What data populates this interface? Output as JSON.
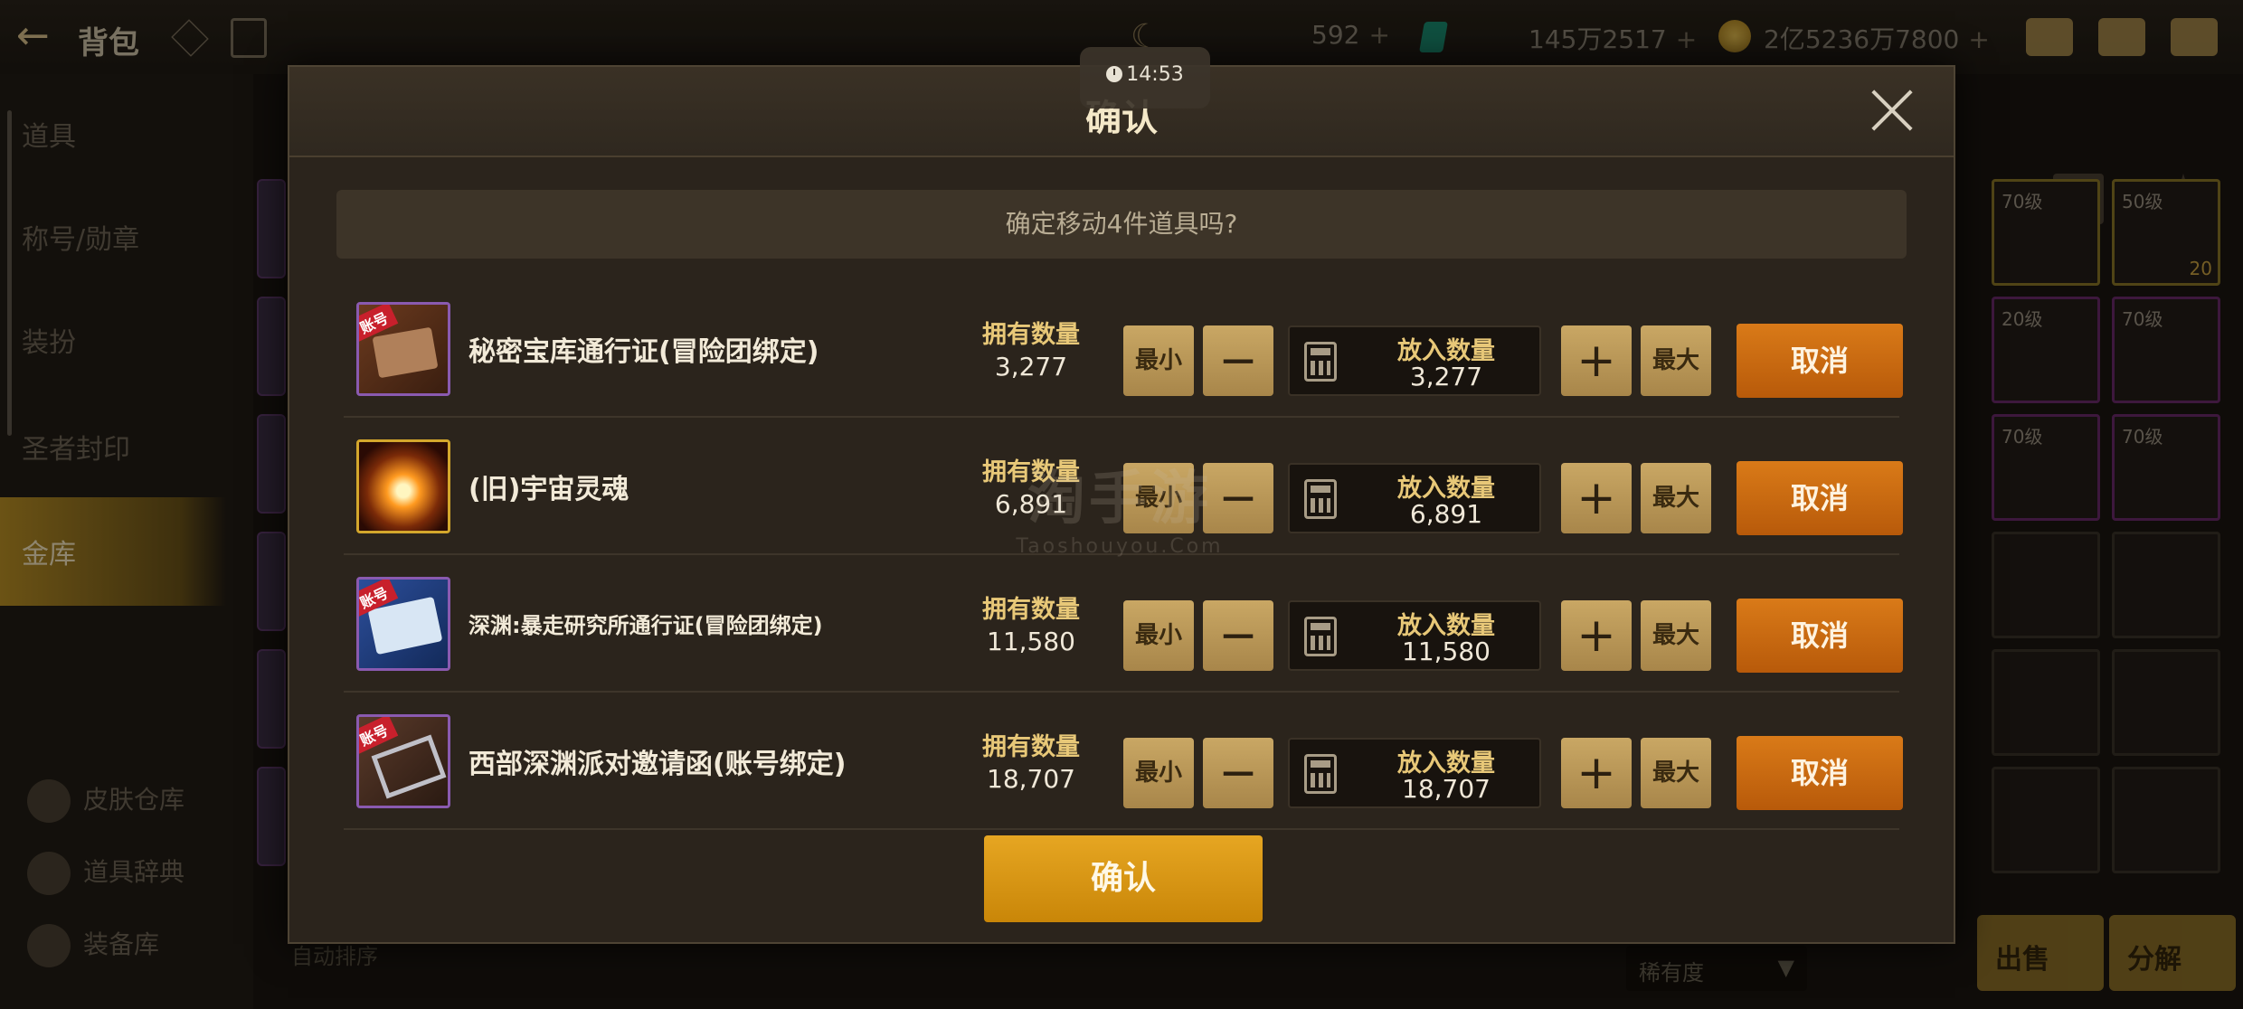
{
  "background": {
    "title": "背包",
    "currencies": [
      {
        "value": "592"
      },
      {
        "value": "145万2517"
      },
      {
        "value": "2亿5236万7800"
      }
    ],
    "sidebar": [
      "道具",
      "称号/勋章",
      "装扮",
      "圣者封印",
      "金库"
    ],
    "sidebar_active": "金库",
    "sidebar_bottom": [
      "皮肤仓库",
      "道具辞典",
      "装备库"
    ],
    "bottom_left": "自动排序",
    "sort_label": "稀有度",
    "right_levels": [
      "70级",
      "50级",
      "20",
      "20级",
      "70级",
      "70级",
      "70级"
    ],
    "buttons": {
      "sell": "出售",
      "decompose": "分解"
    }
  },
  "timer": "14:53",
  "watermark": {
    "big": "淘手游",
    "small": "Taoshouyou.Com"
  },
  "modal": {
    "title": "确认",
    "prompt": "确定移动4件道具吗?",
    "labels": {
      "owned": "拥有数量",
      "put": "放入数量",
      "min": "最小",
      "max": "最大",
      "cancel": "取消"
    },
    "items": [
      {
        "name": "秘密宝库通行证(冒险团绑定)",
        "owned": "3,277",
        "put": "3,277",
        "badge": "账号",
        "icon": "pass-icon"
      },
      {
        "name": "(旧)宇宙灵魂",
        "owned": "6,891",
        "put": "6,891",
        "badge": "",
        "icon": "soul-icon"
      },
      {
        "name": "深渊:暴走研究所通行证(冒险团绑定)",
        "owned": "11,580",
        "put": "11,580",
        "badge": "账号",
        "icon": "abyss-pass-icon"
      },
      {
        "name": "西部深渊派对邀请函(账号绑定)",
        "owned": "18,707",
        "put": "18,707",
        "badge": "账号",
        "icon": "invite-icon"
      }
    ],
    "confirm_label": "确认"
  },
  "colors": {
    "cancel": "#c8650f",
    "confirm": "#d99612",
    "stepper": "#b8965a",
    "label_gold": "#e8c878"
  }
}
